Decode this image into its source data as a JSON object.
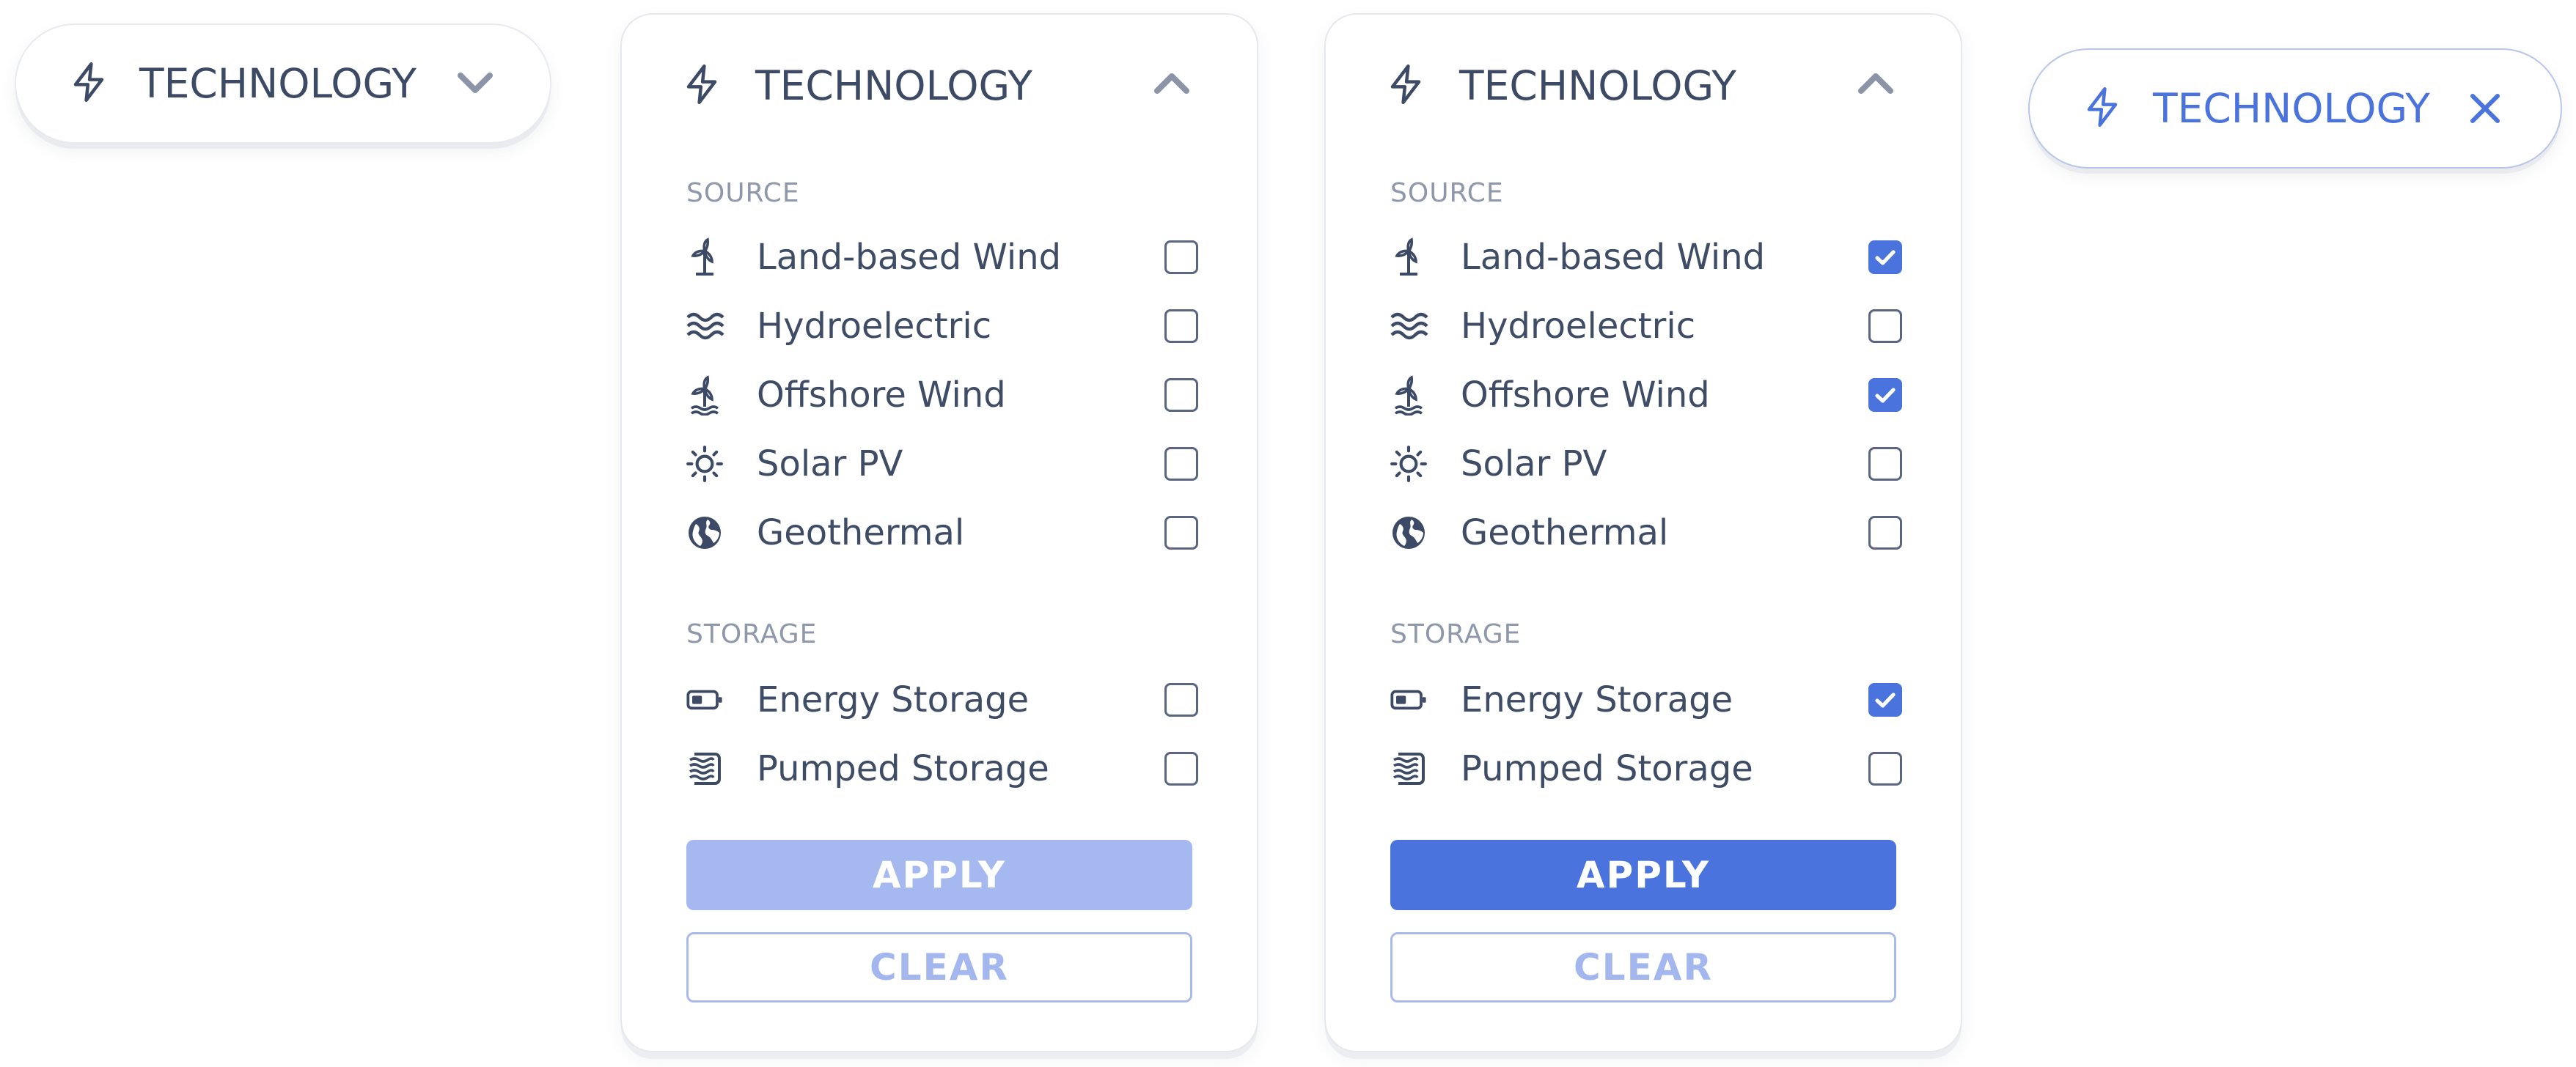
{
  "colors": {
    "accent": "#4a73de",
    "accent_disabled": "#a5b9f0",
    "text": "#3c4a65",
    "muted": "#8f98ab"
  },
  "pill_collapsed": {
    "icon": "lightning-bolt-icon",
    "label": "TECHNOLOGY",
    "toggle_icon": "chevron-down-icon"
  },
  "pill_active": {
    "icon": "lightning-bolt-icon",
    "label": "TECHNOLOGY",
    "close_icon": "close-icon"
  },
  "panel_empty": {
    "title": "TECHNOLOGY",
    "source_label": "SOURCE",
    "storage_label": "STORAGE",
    "source_items": [
      {
        "label": "Land-based Wind",
        "icon": "wind-turbine-icon",
        "checked": false
      },
      {
        "label": "Hydroelectric",
        "icon": "waves-icon",
        "checked": false
      },
      {
        "label": "Offshore Wind",
        "icon": "offshore-wind-turbine-icon",
        "checked": false
      },
      {
        "label": "Solar PV",
        "icon": "sun-icon",
        "checked": false
      },
      {
        "label": "Geothermal",
        "icon": "globe-icon",
        "checked": false
      }
    ],
    "storage_items": [
      {
        "label": "Energy Storage",
        "icon": "battery-icon",
        "checked": false
      },
      {
        "label": "Pumped Storage",
        "icon": "pumped-storage-icon",
        "checked": false
      }
    ],
    "apply_label": "APPLY",
    "apply_enabled": false,
    "clear_label": "CLEAR"
  },
  "panel_selected": {
    "title": "TECHNOLOGY",
    "source_label": "SOURCE",
    "storage_label": "STORAGE",
    "source_items": [
      {
        "label": "Land-based Wind",
        "icon": "wind-turbine-icon",
        "checked": true
      },
      {
        "label": "Hydroelectric",
        "icon": "waves-icon",
        "checked": false
      },
      {
        "label": "Offshore Wind",
        "icon": "offshore-wind-turbine-icon",
        "checked": true
      },
      {
        "label": "Solar PV",
        "icon": "sun-icon",
        "checked": false
      },
      {
        "label": "Geothermal",
        "icon": "globe-icon",
        "checked": false
      }
    ],
    "storage_items": [
      {
        "label": "Energy Storage",
        "icon": "battery-icon",
        "checked": true
      },
      {
        "label": "Pumped Storage",
        "icon": "pumped-storage-icon",
        "checked": false
      }
    ],
    "apply_label": "APPLY",
    "apply_enabled": true,
    "clear_label": "CLEAR"
  }
}
